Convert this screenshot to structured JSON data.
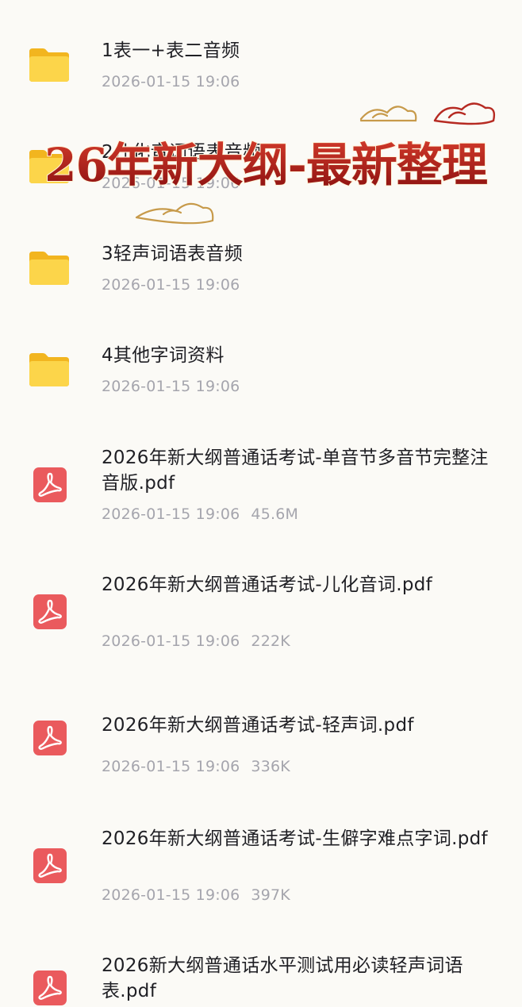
{
  "files": [
    {
      "type": "folder",
      "name": "1表一+表二音频",
      "date": "2026-01-15 19:06",
      "size": ""
    },
    {
      "type": "folder",
      "name": "2儿化音词语表音频",
      "date": "2026-01-15 19:06",
      "size": ""
    },
    {
      "type": "folder",
      "name": "3轻声词语表音频",
      "date": "2026-01-15 19:06",
      "size": ""
    },
    {
      "type": "folder",
      "name": "4其他字词资料",
      "date": "2026-01-15 19:06",
      "size": ""
    },
    {
      "type": "pdf",
      "name": "2026年新大纲普通话考试-单音节多音节完整注音版.pdf",
      "date": "2026-01-15 19:06",
      "size": "45.6M"
    },
    {
      "type": "pdf",
      "name": "2026年新大纲普通话考试-儿化音词.pdf",
      "date": "2026-01-15 19:06",
      "size": "222K"
    },
    {
      "type": "pdf",
      "name": "2026年新大纲普通话考试-轻声词.pdf",
      "date": "2026-01-15 19:06",
      "size": "336K"
    },
    {
      "type": "pdf",
      "name": "2026年新大纲普通话考试-生僻字难点字词.pdf",
      "date": "2026-01-15 19:06",
      "size": "397K"
    },
    {
      "type": "pdf",
      "name": "2026新大纲普通话水平测试用必读轻声词语表.pdf",
      "date": "",
      "size": ""
    }
  ],
  "overlay": {
    "text": "26年新大纲-最新整理"
  },
  "icons": {
    "folder": "folder-icon",
    "pdf": "pdf-icon"
  },
  "colors": {
    "folder": "#f7c836",
    "pdf": "#ea5a5d",
    "overlay_red": "#b01b1b",
    "overlay_gold": "#d49a2e"
  }
}
